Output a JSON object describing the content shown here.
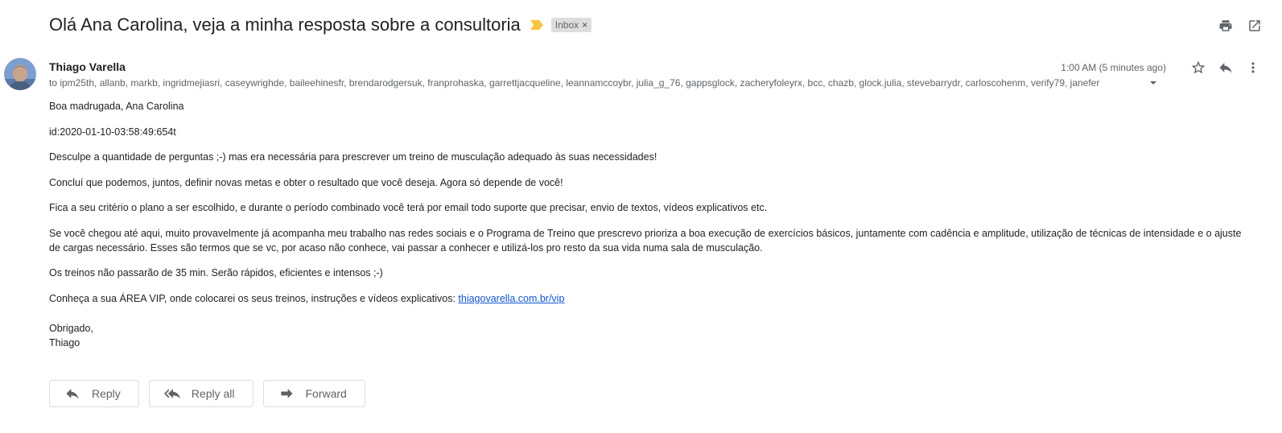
{
  "header": {
    "subject": "Olá Ana Carolina, veja a minha resposta sobre a consultoria",
    "label": "Inbox",
    "label_close": "×",
    "important_color": "#f6c343",
    "print_icon": "print-icon",
    "open_new_window_icon": "open-in-new-icon"
  },
  "message": {
    "sender": "Thiago Varella",
    "recipients": "to ipm25th, allanb, markb, ingridmejiasri, caseywrighde, baileehinesfr, brendarodgersuk, franprohaska, garrettjacqueline, leannamccoybr, julia_g_76, gappsglock, zacheryfoleyrx, bcc, chazb, glock.julia, stevebarrydr, carloscohenm, verify79, janefer",
    "timestamp": "1:00 AM (5 minutes ago)",
    "star_icon": "star-outline-icon",
    "reply_icon": "reply-icon",
    "more_icon": "more-vert-icon"
  },
  "body": {
    "greeting": "Boa madrugada, Ana Carolina",
    "id_line": "id:2020-01-10-03:58:49:654t",
    "p1": "Desculpe a quantidade de perguntas ;-) mas era necessária para prescrever um treino de musculação adequado às suas necessidades!",
    "p2": "Concluí que podemos, juntos, definir novas metas e obter o resultado que você deseja. Agora só depende de você!",
    "p3": "Fica a seu critério o plano a ser escolhido, e durante o período combinado você terá por email todo suporte que precisar, envio de textos, vídeos explicativos etc.",
    "p4": "Se você chegou até aqui, muito provavelmente já acompanha meu trabalho nas redes sociais e o Programa de Treino que prescrevo prioriza a boa execução de exercícios básicos, juntamente com cadência e amplitude, utilização de técnicas de intensidade e o ajuste de cargas necessário. Esses são termos que se vc, por acaso não conhece, vai passar a conhecer e utilizá-los pro resto da sua vida numa sala de musculação.",
    "p5": "Os treinos não passarão de 35 min. Serão rápidos, eficientes e intensos ;-)",
    "p6": "Conheça a sua ÁREA VIP, onde colocarei os seus treinos, instruções e vídeos explicativos: ",
    "link": "thiagovarella.com.br/vip",
    "signoff1": "Obrigado,",
    "signoff2": "Thiago"
  },
  "actions": {
    "reply": "Reply",
    "reply_all": "Reply all",
    "forward": "Forward"
  }
}
